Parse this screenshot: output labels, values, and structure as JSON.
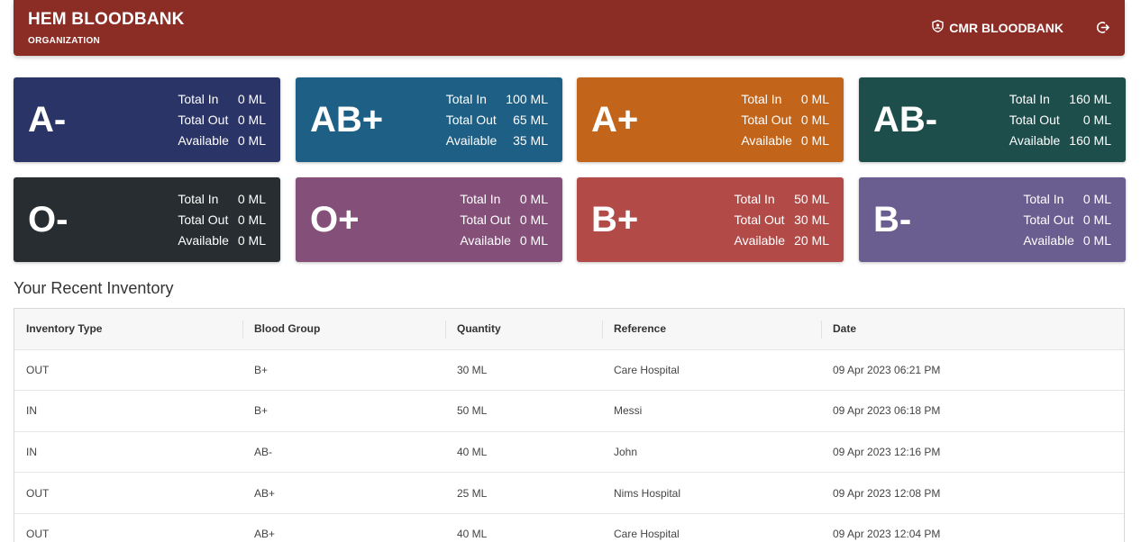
{
  "header": {
    "title": "HEM BLOODBANK",
    "subtitle": "ORGANIZATION",
    "user_label": "CMR BLOODBANK",
    "user_icon": "shield-user-icon",
    "logout_icon": "logout-icon",
    "background": "#8b2c25"
  },
  "cards": [
    {
      "group": "A-",
      "labels": {
        "in": "Total In",
        "out": "Total Out",
        "avail": "Available"
      },
      "total_in": "0 ML",
      "total_out": "0 ML",
      "available": "0 ML",
      "color": "#2b3466"
    },
    {
      "group": "AB+",
      "labels": {
        "in": "Total In",
        "out": "Total Out",
        "avail": "Available"
      },
      "total_in": "100 ML",
      "total_out": "65 ML",
      "available": "35 ML",
      "color": "#1d5f85"
    },
    {
      "group": "A+",
      "labels": {
        "in": "Total In",
        "out": "Total Out",
        "avail": "Available"
      },
      "total_in": "0 ML",
      "total_out": "0 ML",
      "available": "0 ML",
      "color": "#c2641a"
    },
    {
      "group": "AB-",
      "labels": {
        "in": "Total In",
        "out": "Total Out",
        "avail": "Available"
      },
      "total_in": "160 ML",
      "total_out": "0 ML",
      "available": "160 ML",
      "color": "#1d4e4b"
    },
    {
      "group": "O-",
      "labels": {
        "in": "Total In",
        "out": "Total Out",
        "avail": "Available"
      },
      "total_in": "0 ML",
      "total_out": "0 ML",
      "available": "0 ML",
      "color": "#272d30"
    },
    {
      "group": "O+",
      "labels": {
        "in": "Total In",
        "out": "Total Out",
        "avail": "Available"
      },
      "total_in": "0 ML",
      "total_out": "0 ML",
      "available": "0 ML",
      "color": "#844f79"
    },
    {
      "group": "B+",
      "labels": {
        "in": "Total In",
        "out": "Total Out",
        "avail": "Available"
      },
      "total_in": "50 ML",
      "total_out": "30 ML",
      "available": "20 ML",
      "color": "#b24b48"
    },
    {
      "group": "B-",
      "labels": {
        "in": "Total In",
        "out": "Total Out",
        "avail": "Available"
      },
      "total_in": "0 ML",
      "total_out": "0 ML",
      "available": "0 ML",
      "color": "#6a5d8f"
    }
  ],
  "inventory": {
    "title": "Your Recent Inventory",
    "columns": [
      "Inventory Type",
      "Blood Group",
      "Quantity",
      "Reference",
      "Date"
    ],
    "rows": [
      [
        "OUT",
        "B+",
        "30 ML",
        "Care Hospital",
        "09 Apr 2023 06:21 PM"
      ],
      [
        "IN",
        "B+",
        "50 ML",
        "Messi",
        "09 Apr 2023 06:18 PM"
      ],
      [
        "IN",
        "AB-",
        "40 ML",
        "John",
        "09 Apr 2023 12:16 PM"
      ],
      [
        "OUT",
        "AB+",
        "25 ML",
        "Nims Hospital",
        "09 Apr 2023 12:08 PM"
      ],
      [
        "OUT",
        "AB+",
        "40 ML",
        "Care Hospital",
        "09 Apr 2023 12:04 PM"
      ]
    ]
  }
}
